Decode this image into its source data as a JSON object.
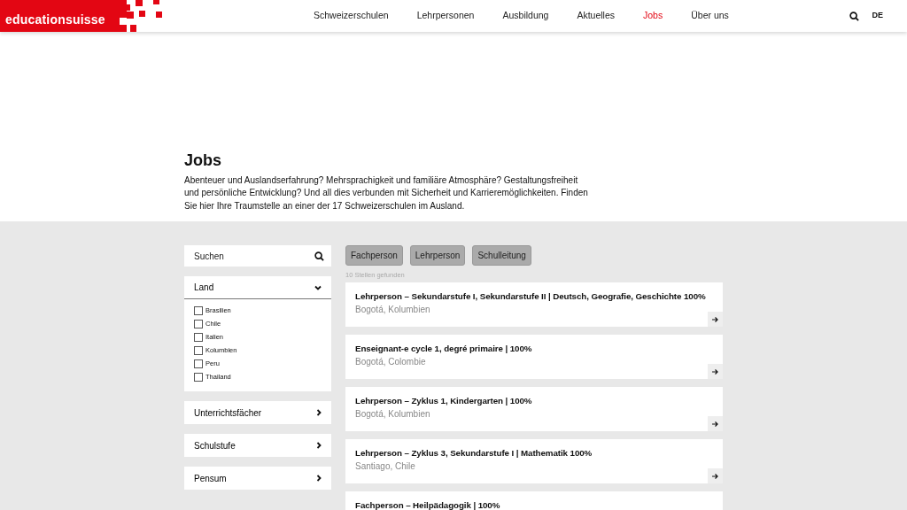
{
  "header": {
    "logo": "educationsuisse",
    "nav": [
      {
        "label": "Schweizerschulen",
        "selected": false
      },
      {
        "label": "Lehrpersonen",
        "selected": false
      },
      {
        "label": "Ausbildung",
        "selected": false
      },
      {
        "label": "Aktuelles",
        "selected": false
      },
      {
        "label": "Jobs",
        "selected": true
      },
      {
        "label": "Über uns",
        "selected": false
      }
    ],
    "language": {
      "label": "DE",
      "selected": true
    }
  },
  "intro": {
    "title": "Jobs",
    "text": "Abenteuer und Auslandserfahrung? Mehrsprachigkeit und familiäre Atmosphäre? Gestaltungsfreiheit und persönliche Entwicklung? Und all dies verbunden mit Sicherheit und Karrieremöglichkeiten. Finden Sie hier Ihre Traumstelle an einer der 17 Schweizerschulen im Ausland."
  },
  "filters": {
    "search": {
      "placeholder": "Suchen"
    },
    "groups": [
      {
        "label": "Land",
        "expanded": true,
        "options": [
          {
            "label": "Brasilien",
            "checked": false
          },
          {
            "label": "Chile",
            "checked": false
          },
          {
            "label": "Italien",
            "checked": false
          },
          {
            "label": "Kolumbien",
            "checked": false
          },
          {
            "label": "Peru",
            "checked": false
          },
          {
            "label": "Thailand",
            "checked": false
          }
        ]
      },
      {
        "label": "Unterrichtsfächer",
        "expanded": false
      },
      {
        "label": "Schulstufe",
        "expanded": false
      },
      {
        "label": "Pensum",
        "expanded": false
      }
    ]
  },
  "categories": [
    {
      "label": "Fachperson"
    },
    {
      "label": "Lehrperson"
    },
    {
      "label": "Schulleitung"
    }
  ],
  "result_count": "10 Stellen gefunden",
  "jobs": [
    {
      "title": "Lehrperson – Sekundarstufe I, Sekundarstufe II | Deutsch, Geografie, Geschichte 100%",
      "location": "Bogotá, Kolumbien"
    },
    {
      "title": "Enseignant-e cycle 1, degré primaire | 100%",
      "location": "Bogotá, Colombie"
    },
    {
      "title": "Lehrperson – Zyklus 1, Kindergarten | 100%",
      "location": "Bogotá, Kolumbien"
    },
    {
      "title": "Lehrperson – Zyklus 3, Sekundarstufe I | Mathematik 100%",
      "location": "Santiago, Chile"
    },
    {
      "title": "Fachperson – Heilpädagogik | 100%"
    }
  ]
}
